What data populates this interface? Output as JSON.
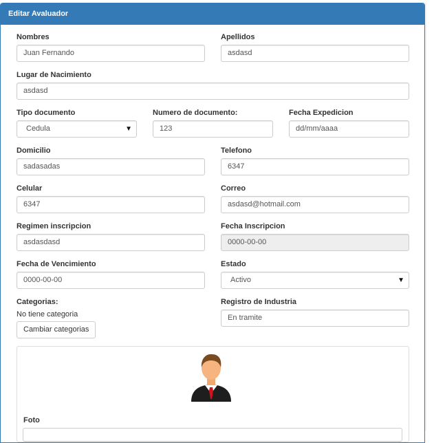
{
  "panel": {
    "title": "Editar Avaluador"
  },
  "form": {
    "nombres": {
      "label": "Nombres",
      "value": "Juan Fernando"
    },
    "apellidos": {
      "label": "Apellidos",
      "value": "asdasd"
    },
    "lugar_nacimiento": {
      "label": "Lugar de Nacimiento",
      "value": "asdasd"
    },
    "tipo_documento": {
      "label": "Tipo documento",
      "value": "Cedula"
    },
    "numero_documento": {
      "label": "Numero de documento:",
      "value": "123"
    },
    "fecha_expedicion": {
      "label": "Fecha Expedicion",
      "value": "dd/mm/aaaa"
    },
    "domicilio": {
      "label": "Domicilio",
      "value": "sadasadas"
    },
    "telefono": {
      "label": "Telefono",
      "value": "6347"
    },
    "celular": {
      "label": "Celular",
      "value": "6347"
    },
    "correo": {
      "label": "Correo",
      "value": "asdasd@hotmail.com"
    },
    "regimen": {
      "label": "Regimen inscripcion",
      "value": "asdasdasd"
    },
    "fecha_inscripcion": {
      "label": "Fecha Inscripcion",
      "value": "0000-00-00"
    },
    "fecha_vencimiento": {
      "label": "Fecha de Vencimiento",
      "value": "0000-00-00"
    },
    "estado": {
      "label": "Estado",
      "value": "Activo"
    },
    "categorias": {
      "label": "Categorias:",
      "text": "No tiene categoria",
      "button": "Cambiar categorias"
    },
    "registro_industria": {
      "label": "Registro de Industria",
      "value": "En tramite"
    },
    "foto": {
      "label": "Foto"
    }
  },
  "icons": {
    "avatar": "person-avatar-icon",
    "dropdown": "caret-down-icon"
  },
  "colors": {
    "header": "#337ab7",
    "border": "#cccccc",
    "disabled": "#eeeeee"
  }
}
